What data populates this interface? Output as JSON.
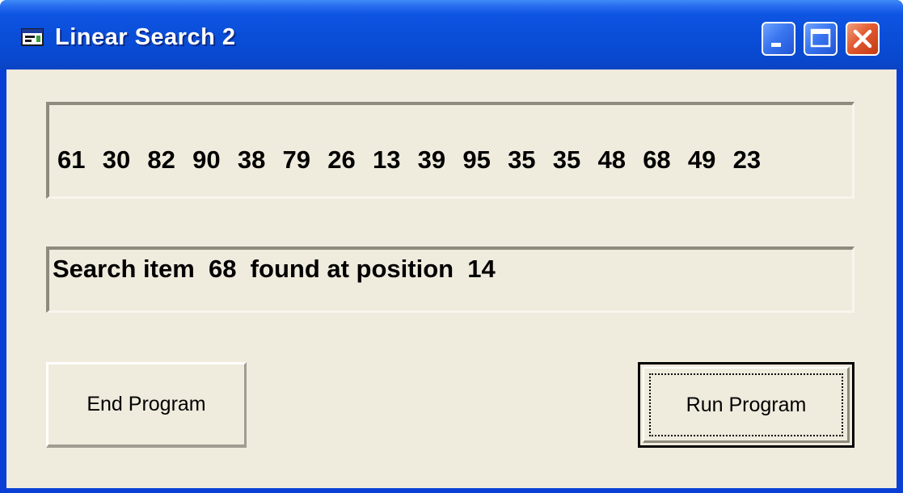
{
  "window": {
    "title": "Linear Search 2",
    "app_icon": "vb-form-icon",
    "controls": {
      "minimize_icon": "minimize-icon",
      "maximize_icon": "maximize-icon",
      "close_icon": "close-icon"
    }
  },
  "numbers_display": {
    "text": "61  30  82  90  38  79  26  13  39  95  35  35  48  68  49  23"
  },
  "result_display": {
    "text": "Search item  68  found at position  14"
  },
  "buttons": {
    "end_label": "End Program",
    "run_label": "Run Program"
  },
  "colors": {
    "titlebar": "#0a4ed8",
    "client_background": "#efebdd",
    "close_button": "#e25a30"
  }
}
